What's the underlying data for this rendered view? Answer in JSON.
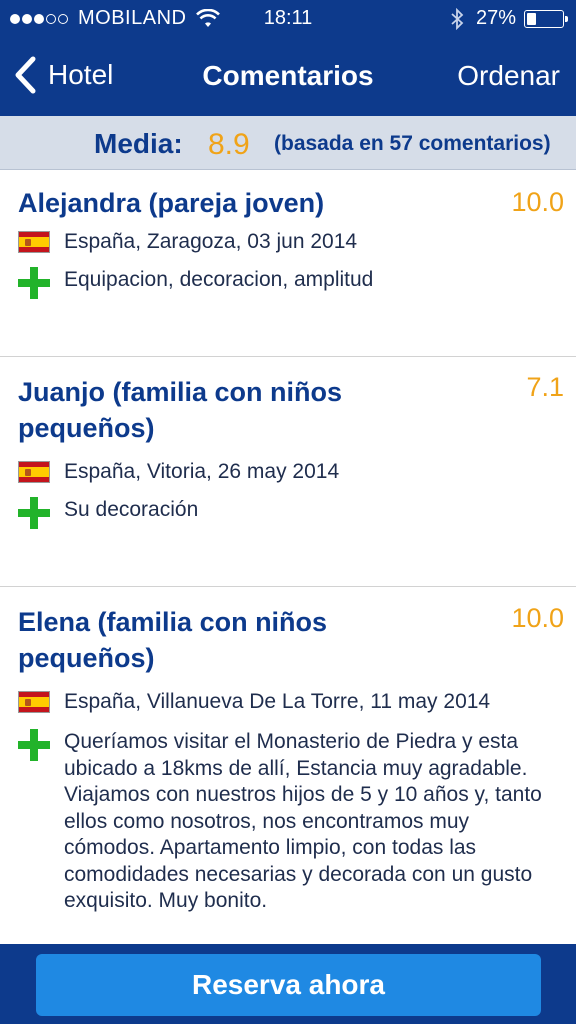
{
  "status_bar": {
    "carrier": "MOBILAND",
    "time": "18:11",
    "battery": "27%",
    "signal_bars": 3,
    "battery_level": 0.27
  },
  "nav": {
    "back_label": "Hotel",
    "title": "Comentarios",
    "sort_label": "Ordenar"
  },
  "summary": {
    "label": "Media:",
    "score": "8.9",
    "count_text": "(basada en 57 comentarios)"
  },
  "reviews": [
    {
      "reviewer": "Alejandra (pareja joven)",
      "score": "10.0",
      "meta": "España, Zaragoza, 03 jun 2014",
      "pro": "Equipacion, decoracion, amplitud"
    },
    {
      "reviewer": "Juanjo (familia con niños pequeños)",
      "score": "7.1",
      "meta": "España, Vitoria, 26 may 2014",
      "pro": "Su decoración"
    },
    {
      "reviewer": "Elena (familia con niños pequeños)",
      "score": "10.0",
      "meta": "España, Villanueva De La Torre, 11 may 2014",
      "pro": "Queríamos visitar el Monasterio de Piedra y esta ubicado a 18kms de allí, Estancia muy agradable. Viajamos con nuestros hijos de 5 y 10 años y, tanto ellos como nosotros, nos encontramos muy cómodos. Apartamento limpio, con todas las comodidades necesarias y decorada con un gusto exquisito. Muy bonito."
    }
  ],
  "footer": {
    "book_label": "Reserva ahora"
  },
  "colors": {
    "brand_blue": "#0d3a8c",
    "score_orange": "#f0a318",
    "button_blue": "#1f89e3",
    "pro_green": "#22b32a"
  }
}
